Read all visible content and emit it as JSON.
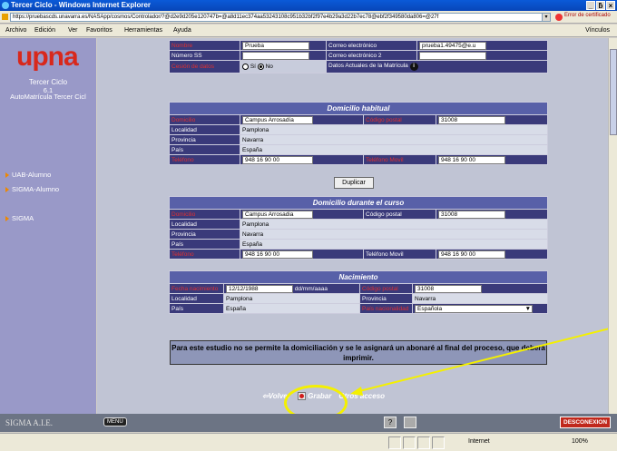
{
  "window": {
    "title": "Tercer Ciclo - Windows Internet Explorer",
    "controls": [
      "_",
      "ƃ",
      "×"
    ]
  },
  "address": {
    "url": "https://pruebascds.unavarra.es/NASApp/cosmos/Controlador/?@d2e9d205e120747b=@a8d11ec374aa53243108c951b32bf2f97e4b29a3d22b7ec78@ebf2f349580da806=@27f",
    "cert_error": "Error de certificado"
  },
  "menu": {
    "items": [
      "Archivo",
      "Edición",
      "Ver",
      "Favoritos",
      "Herramientas",
      "Ayuda"
    ],
    "links": "Vínculos"
  },
  "sidebar": {
    "logo": "upna",
    "title": "Tercer Ciclo",
    "version": "6.1",
    "subtitle": "AutoMatrícula Tercer Cicl",
    "links": [
      "UAB-Alumno",
      "SIGMA-Alumno",
      "SIGMA"
    ]
  },
  "top": {
    "nombre_label": "Nombre",
    "nombre_val": "Prueba",
    "email_label": "Correo electrónico",
    "email_val": "prueba1.49475@e.u",
    "nss_label": "Número SS",
    "email2_label": "Correo electrónico 2",
    "cesion_label": "Cesión de datos",
    "si": "Sí",
    "no": "No",
    "datos_actuales": "Datos Actuales de la Matrícula",
    "info": "i"
  },
  "habitual": {
    "heading": "Domicilio habitual",
    "domicilio_label": "Domicilio",
    "domicilio_val": "Campus Arrosadía",
    "cp_label": "Código postal",
    "cp_val": "31008",
    "localidad_label": "Localidad",
    "localidad_val": "Pamplona",
    "provincia_label": "Provincia",
    "provincia_val": "Navarra",
    "pais_label": "País",
    "pais_val": "España",
    "telefono_label": "Teléfono",
    "telefono_val": "948 16 90 00",
    "movil_label": "Teléfono Movil",
    "movil_val": "948 16 90 00"
  },
  "duplicar": "Duplicar",
  "curso": {
    "heading": "Domicilio durante el curso",
    "domicilio_label": "Domicilio",
    "domicilio_val": "Campus Arrosadia",
    "cp_label": "Código postal",
    "cp_val": "31008",
    "localidad_label": "Localidad",
    "localidad_val": "Pamplona",
    "provincia_label": "Provincia",
    "provincia_val": "Navarra",
    "pais_label": "País",
    "pais_val": "España",
    "telefono_label": "Teléfono",
    "telefono_val": "948 16 90 00",
    "movil_label": "Teléfono Movil",
    "movil_val": "948 16 90 00"
  },
  "nacimiento": {
    "heading": "Nacimiento",
    "fecha_label": "Fecha nacimiento",
    "fecha_val": "12/12/1988",
    "fecha_fmt": "dd/mm/aaaa",
    "cp_label": "Código postal",
    "cp_val": "31008",
    "localidad_label": "Localidad",
    "localidad_val": "Pamplona",
    "provincia_label": "Provincia",
    "provincia_val": "Navarra",
    "pais_label": "País",
    "pais_val": "España",
    "nac_label": "País nacionalidad",
    "nac_val": "Española"
  },
  "note": "Para este estudio no se permite la domiciliación y se le asignará un abonaré al final del proceso, que deberá imprimir.",
  "actions": {
    "volver": "Volver",
    "grabar": "Grabar",
    "otros": "Otros acceso"
  },
  "bottom": {
    "sigma": "SIGMA A.I.E.",
    "menu": "MENU",
    "help": "?",
    "desconexion": "DESCONEXION"
  },
  "status": {
    "internet": "Internet",
    "zoom": "100%"
  }
}
